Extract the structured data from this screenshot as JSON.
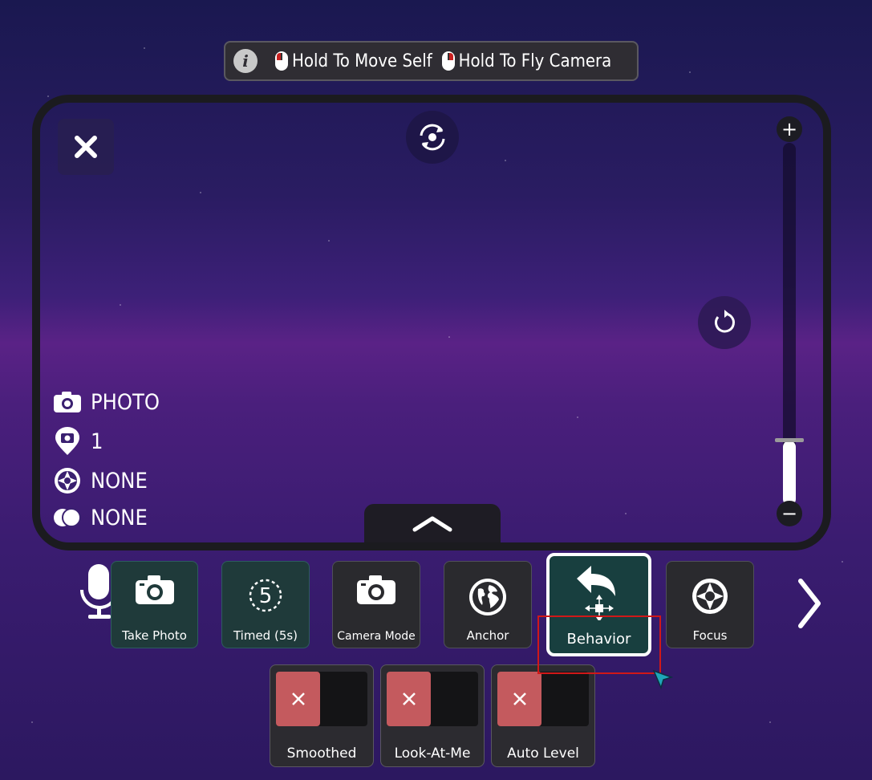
{
  "hint_bar": {
    "move_self": "Hold To Move Self",
    "fly_camera": "Hold To Fly Camera"
  },
  "status": {
    "mode": "PHOTO",
    "anchor_count": "1",
    "focus": "NONE",
    "filter": "NONE"
  },
  "zoom": {
    "level_fraction": 0.18
  },
  "toolbar": {
    "take_photo": "Take Photo",
    "timed": "Timed (5s)",
    "timer_digit": "5",
    "camera_mode": "Camera Mode",
    "anchor": "Anchor",
    "behavior": "Behavior",
    "focus": "Focus"
  },
  "toggles": [
    {
      "label": "Smoothed",
      "state": "off"
    },
    {
      "label": "Look-At-Me",
      "state": "off"
    },
    {
      "label": "Auto Level",
      "state": "off"
    }
  ],
  "colors": {
    "accent_teal": "#183f3f",
    "toggle_off": "#c45a5e",
    "highlight": "#d01818"
  }
}
